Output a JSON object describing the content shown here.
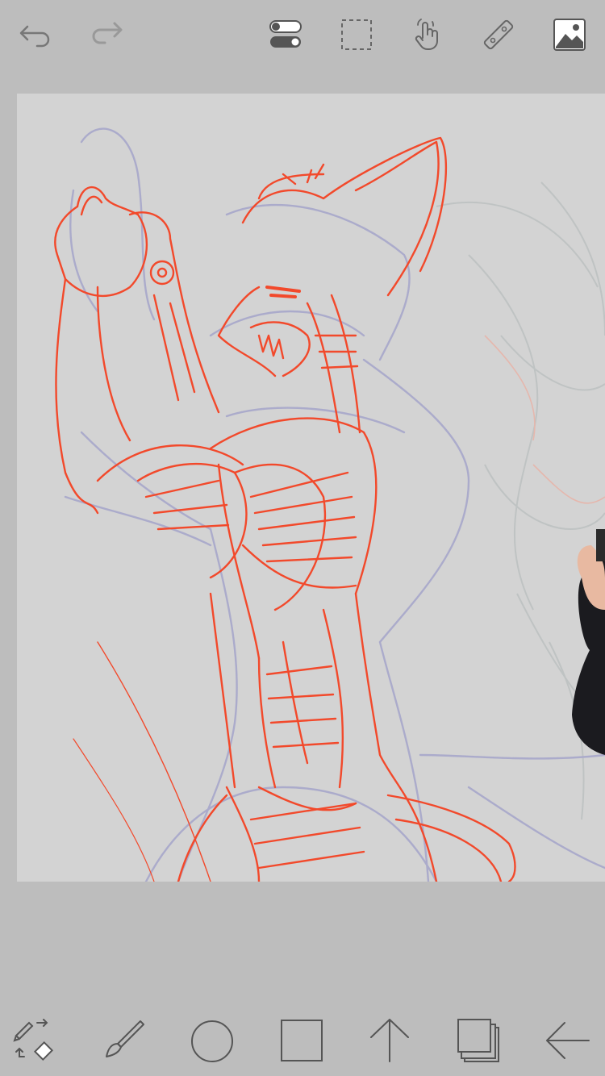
{
  "app": {
    "accent_color": "#f2492b",
    "sketch_color": "#a9a9c9",
    "canvas_bg": "#d3d3d3"
  },
  "top_toolbar": {
    "items": [
      {
        "name": "undo",
        "icon": "undo-arrow-icon"
      },
      {
        "name": "redo",
        "icon": "redo-arrow-icon",
        "disabled": true
      },
      {
        "name": "toggle-settings",
        "icon": "toggle-switches-icon"
      },
      {
        "name": "selection",
        "icon": "dashed-selection-icon"
      },
      {
        "name": "gesture",
        "icon": "hand-tap-icon"
      },
      {
        "name": "ruler",
        "icon": "ruler-icon"
      },
      {
        "name": "image-import",
        "icon": "image-icon"
      }
    ]
  },
  "bottom_toolbar": {
    "items": [
      {
        "name": "tool-switcher",
        "icon": "brush-eraser-swap-icon"
      },
      {
        "name": "brush",
        "icon": "brush-icon"
      },
      {
        "name": "color",
        "icon": "color-circle-icon"
      },
      {
        "name": "shape",
        "icon": "square-icon"
      },
      {
        "name": "transform",
        "icon": "up-arrow-icon"
      },
      {
        "name": "layers",
        "icon": "layers-icon"
      },
      {
        "name": "back",
        "icon": "left-arrow-icon"
      }
    ]
  }
}
